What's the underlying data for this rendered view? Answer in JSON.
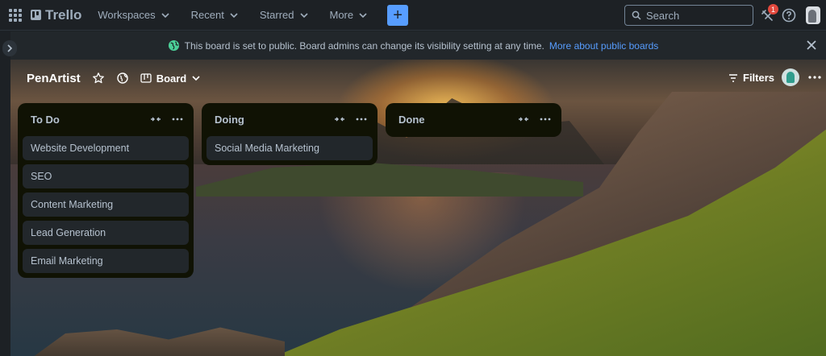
{
  "topnav": {
    "logo_text": "Trello",
    "menu": [
      {
        "label": "Workspaces"
      },
      {
        "label": "Recent"
      },
      {
        "label": "Starred"
      },
      {
        "label": "More"
      }
    ],
    "create_label": "+",
    "search_placeholder": "Search",
    "notifications_count": "1"
  },
  "banner": {
    "message": "This board is set to public. Board admins can change its visibility setting at any time.",
    "link_text": "More about public boards"
  },
  "board": {
    "title": "PenArtist",
    "view_label": "Board",
    "filters_label": "Filters"
  },
  "lists": [
    {
      "title": "To Do",
      "cards": [
        "Website Development",
        "SEO",
        "Content Marketing",
        "Lead Generation",
        "Email Marketing"
      ]
    },
    {
      "title": "Doing",
      "cards": [
        "Social Media Marketing"
      ]
    },
    {
      "title": "Done",
      "cards": []
    }
  ],
  "colors": {
    "accent": "#579dff",
    "badge": "#e2483d",
    "list_bg": "#101204",
    "card_bg": "#22272b"
  }
}
